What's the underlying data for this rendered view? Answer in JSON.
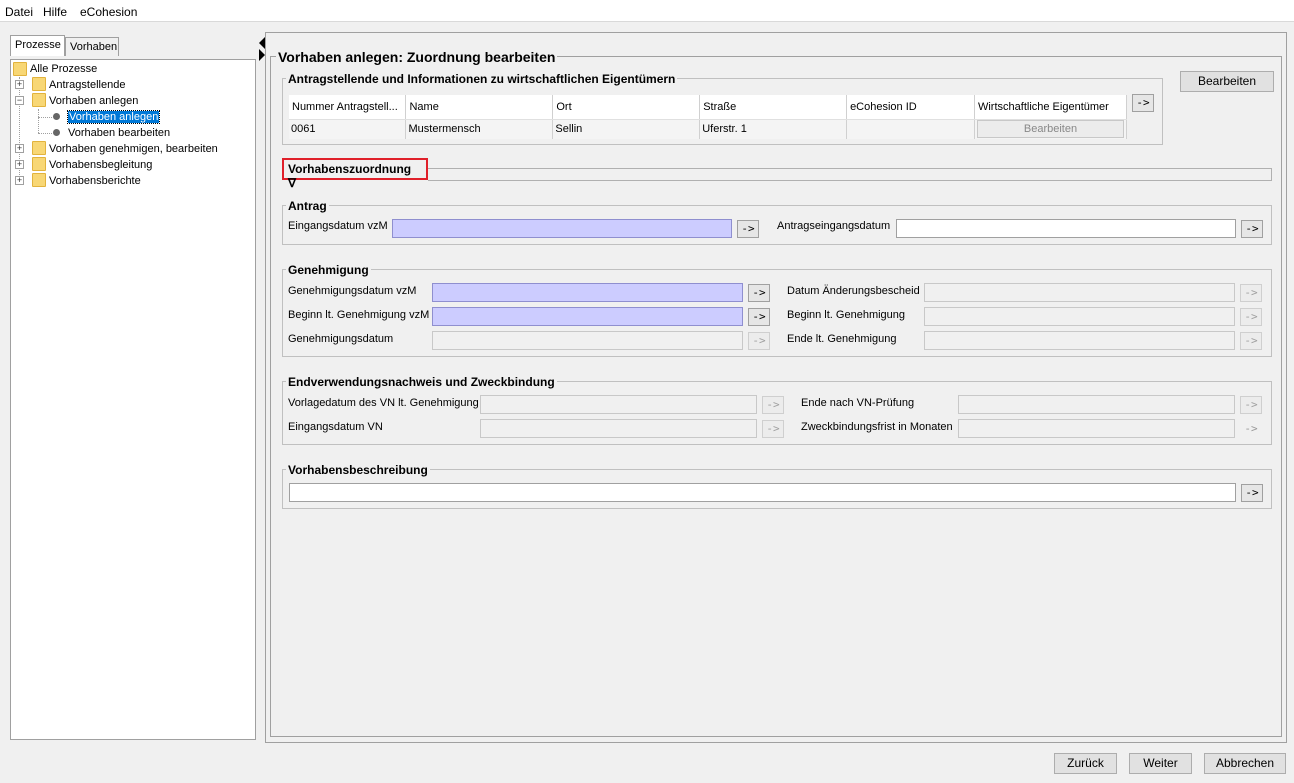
{
  "menu": {
    "items": [
      "Datei",
      "Hilfe",
      "eCohesion"
    ]
  },
  "left_tabs": [
    "Prozesse",
    "Vorhaben"
  ],
  "tree": {
    "root": "Alle Prozesse",
    "nodes": [
      "Antragstellende",
      "Vorhaben anlegen",
      "Vorhaben anlegen",
      "Vorhaben bearbeiten",
      "Vorhaben genehmigen, bearbeiten",
      "Vorhabensbegleitung",
      "Vorhabensberichte"
    ]
  },
  "main": {
    "title": "Vorhaben anlegen: Zuordnung bearbeiten",
    "applicants": {
      "title": "Antragstellende und Informationen zu wirtschaftlichen Eigentümern",
      "columns": [
        "Nummer Antragstell...",
        "Name",
        "Ort",
        "Straße",
        "eCohesion ID",
        "Wirtschaftliche Eigentümer"
      ],
      "row": {
        "nummer": "0061",
        "name": "Mustermensch",
        "ort": "Sellin",
        "strasse": "Uferstr. 1",
        "ecohesion_id": "",
        "eigentuemer_button": "Bearbeiten"
      },
      "arrow": "->",
      "edit_button": "Bearbeiten"
    },
    "zuordnung": {
      "label": "Vorhabenszuordnung",
      "icon": "∇"
    },
    "antrag": {
      "title": "Antrag",
      "eingangsdatum_vzm_label": "Eingangsdatum vzM",
      "antragseingangsdatum_label": "Antragseingangsdatum",
      "arrow": "->"
    },
    "genehmigung": {
      "title": "Genehmigung",
      "labels": {
        "genehmigungsdatum_vzm": "Genehmigungsdatum vzM",
        "beginn_vzm": "Beginn lt. Genehmigung vzM",
        "genehmigungsdatum": "Genehmigungsdatum",
        "datum_aenderung": "Datum Änderungsbescheid",
        "beginn": "Beginn lt. Genehmigung",
        "ende": "Ende lt. Genehmigung"
      },
      "arrow": "->"
    },
    "endverwendung": {
      "title": "Endverwendungsnachweis und Zweckbindung",
      "labels": {
        "vorlagedatum": "Vorlagedatum des VN lt. Genehmigung",
        "eingangsdatum_vn": "Eingangsdatum VN",
        "ende_vn": "Ende nach VN-Prüfung",
        "zweckbindungsfrist": "Zweckbindungsfrist in Monaten"
      },
      "arrow": "->"
    },
    "beschreibung": {
      "title": "Vorhabensbeschreibung",
      "arrow": "->"
    }
  },
  "footer": {
    "back": "Zurück",
    "next": "Weiter",
    "cancel": "Abbrechen"
  },
  "colors": {
    "selection": "#0078d7",
    "highlight_border": "#e0202a",
    "mandatory_field": "#ccccff"
  }
}
